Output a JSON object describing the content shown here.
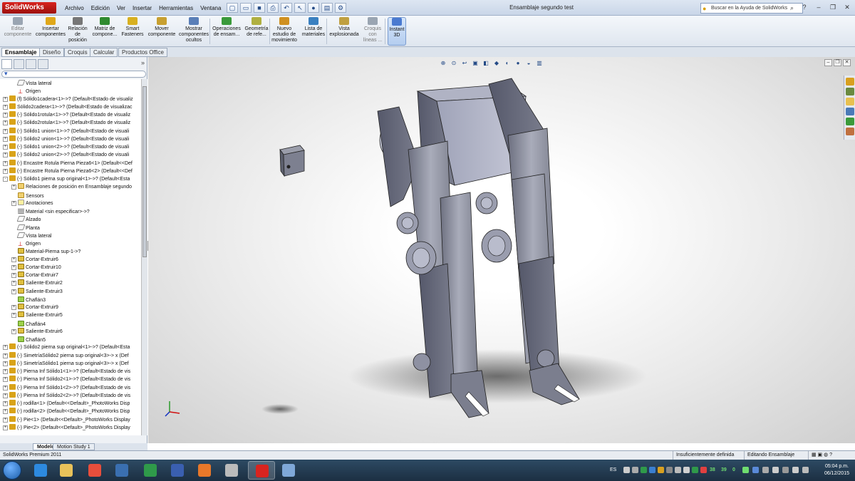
{
  "app": {
    "logo": "SolidWorks",
    "document_title": "Ensamblaje segundo test"
  },
  "menu": [
    "Archivo",
    "Edición",
    "Ver",
    "Insertar",
    "Herramientas",
    "Ventana"
  ],
  "help_search": {
    "placeholder": "Buscar en la Ayuda de SolidWorks"
  },
  "commands": [
    {
      "label": "Editar componente",
      "lines": [
        "Editar",
        "componente"
      ],
      "dim": true,
      "color": "#9aa5b2"
    },
    {
      "label": "Insertar componentes",
      "lines": [
        "Insertar",
        "componentes"
      ],
      "color": "#e0a81a"
    },
    {
      "label": "Relación de posición",
      "lines": [
        "Relación",
        "de",
        "posición"
      ],
      "color": "#777777"
    },
    {
      "label": "Matriz de componente",
      "lines": [
        "Matriz de",
        "compone..."
      ],
      "color": "#2f8a2f"
    },
    {
      "label": "Smart Fasteners",
      "lines": [
        "Smart",
        "Fasteners"
      ],
      "color": "#d8b020"
    },
    {
      "label": "Mover componente",
      "lines": [
        "Mover",
        "componente"
      ],
      "color": "#c8a030"
    },
    {
      "label": "Mostrar componentes ocultos",
      "lines": [
        "Mostrar",
        "componentes",
        "ocultos"
      ],
      "color": "#5a7fb8"
    },
    {
      "label": "Operaciones de ensamblaje",
      "lines": [
        "Operaciones",
        "de ensam..."
      ],
      "color": "#3a9a3a"
    },
    {
      "label": "Geometría de referencia",
      "lines": [
        "Geometría",
        "de refe..."
      ],
      "color": "#b0b040"
    },
    {
      "label": "Nuevo estudio de movimiento",
      "lines": [
        "Nuevo",
        "estudio de",
        "movimiento"
      ],
      "color": "#d09020"
    },
    {
      "label": "Lista de materiales",
      "lines": [
        "Lista de",
        "materiales"
      ],
      "color": "#3a80c0"
    },
    {
      "label": "Vista explosionada",
      "lines": [
        "Vista",
        "explosionada"
      ],
      "color": "#c0a040"
    },
    {
      "label": "Croquis con líneas",
      "lines": [
        "Croquis",
        "con",
        "líneas ..."
      ],
      "dim": true,
      "color": "#9aa5b2"
    },
    {
      "label": "Instant 3D",
      "lines": [
        "Instant",
        "3D"
      ],
      "active": true,
      "color": "#4a7ad0"
    }
  ],
  "command_tabs": [
    "Ensamblaje",
    "Diseño",
    "Croquis",
    "Calcular",
    "Productos Office"
  ],
  "tree": [
    {
      "label": "Vista lateral",
      "icon": "plane",
      "indent": 1,
      "exp": ""
    },
    {
      "label": "Origen",
      "icon": "origin",
      "indent": 1,
      "exp": ""
    },
    {
      "label": "(f) Sólido1cadera<1>->? (Default<Estado de visualiz",
      "icon": "part",
      "indent": 0,
      "exp": "+"
    },
    {
      "label": "Sólido2cadera<1>->? (Default<Estado de visualizac",
      "icon": "part",
      "indent": 0,
      "exp": "+"
    },
    {
      "label": "(-) Sólido1rotula<1>->? (Default<Estado de visualiz",
      "icon": "part",
      "indent": 0,
      "exp": "+"
    },
    {
      "label": "(-) Sólido2rotula<1>->? (Default<Estado de visualiz",
      "icon": "part",
      "indent": 0,
      "exp": "+"
    },
    {
      "label": "(-) Sólido1 union<1>->? (Default<Estado de visuali",
      "icon": "part",
      "indent": 0,
      "exp": "+"
    },
    {
      "label": "(-) Sólido2 union<1>->? (Default<Estado de visuali",
      "icon": "part",
      "indent": 0,
      "exp": "+"
    },
    {
      "label": "(-) Sólido1 union<2>->? (Default<Estado de visuali",
      "icon": "part",
      "indent": 0,
      "exp": "+"
    },
    {
      "label": "(-) Sólido2 union<2>->? (Default<Estado de visuali",
      "icon": "part",
      "indent": 0,
      "exp": "+"
    },
    {
      "label": "(-) Encastre Rotula Pierna Pieza6<1> (Default<<Def",
      "icon": "part",
      "indent": 0,
      "exp": "+"
    },
    {
      "label": "(-) Encastre Rotula Pierna Pieza6<2> (Default<<Def",
      "icon": "part",
      "indent": 0,
      "exp": "+"
    },
    {
      "label": "(-) Sólido1 pierna sup original<1>->? (Default<Esta",
      "icon": "part",
      "indent": 0,
      "exp": "-"
    },
    {
      "label": "Relaciones de posición en Ensamblaje segundo",
      "icon": "folder",
      "indent": 1,
      "exp": "+"
    },
    {
      "label": "Sensors",
      "icon": "folder",
      "indent": 1,
      "exp": ""
    },
    {
      "label": "Anotaciones",
      "icon": "note",
      "indent": 1,
      "exp": "+"
    },
    {
      "label": "Material <sin especificar>->?",
      "icon": "mat",
      "indent": 1,
      "exp": ""
    },
    {
      "label": "Alzado",
      "icon": "plane",
      "indent": 1,
      "exp": ""
    },
    {
      "label": "Planta",
      "icon": "plane",
      "indent": 1,
      "exp": ""
    },
    {
      "label": "Vista lateral",
      "icon": "plane",
      "indent": 1,
      "exp": ""
    },
    {
      "label": "Origen",
      "icon": "origin",
      "indent": 1,
      "exp": ""
    },
    {
      "label": "Material-Pierna sup-1->?",
      "icon": "feat",
      "indent": 1,
      "exp": ""
    },
    {
      "label": "Cortar-Extruir6",
      "icon": "feat",
      "indent": 1,
      "exp": "+"
    },
    {
      "label": "Cortar-Extruir10",
      "icon": "feat",
      "indent": 1,
      "exp": "+"
    },
    {
      "label": "Cortar-Extruir7",
      "icon": "feat",
      "indent": 1,
      "exp": "+"
    },
    {
      "label": "Saliente-Extruir2",
      "icon": "feat",
      "indent": 1,
      "exp": "+"
    },
    {
      "label": "Saliente-Extruir3",
      "icon": "feat",
      "indent": 1,
      "exp": "+"
    },
    {
      "label": "Chaflán3",
      "icon": "chamfer",
      "indent": 1,
      "exp": ""
    },
    {
      "label": "Cortar-Extruir9",
      "icon": "feat",
      "indent": 1,
      "exp": "+"
    },
    {
      "label": "Saliente-Extruir5",
      "icon": "feat",
      "indent": 1,
      "exp": "+"
    },
    {
      "label": "Chaflán4",
      "icon": "chamfer",
      "indent": 1,
      "exp": ""
    },
    {
      "label": "Saliente-Extruir6",
      "icon": "feat",
      "indent": 1,
      "exp": "+"
    },
    {
      "label": "Chaflán5",
      "icon": "chamfer",
      "indent": 1,
      "exp": ""
    },
    {
      "label": "(-) Sólido2 pierna sup original<1>->? (Default<Esta",
      "icon": "part",
      "indent": 0,
      "exp": "+"
    },
    {
      "label": "(-) SimetríaSólido2 pierna sup original<3>-> x (Def",
      "icon": "part",
      "indent": 0,
      "exp": "+"
    },
    {
      "label": "(-) SimetríaSólido1 pierna sup original<3>-> x (Def",
      "icon": "part",
      "indent": 0,
      "exp": "+"
    },
    {
      "label": "(-) Pierna Inf Sólido1<1>->? (Default<Estado de vis",
      "icon": "part",
      "indent": 0,
      "exp": "+"
    },
    {
      "label": "(-) Pierna Inf Sólido2<1>->? (Default<Estado de vis",
      "icon": "part",
      "indent": 0,
      "exp": "+"
    },
    {
      "label": "(-) Pierna Inf Sólido1<2>->? (Default<Estado de vis",
      "icon": "part",
      "indent": 0,
      "exp": "+"
    },
    {
      "label": "(-) Pierna Inf Sólido2<2>->? (Default<Estado de vis",
      "icon": "part",
      "indent": 0,
      "exp": "+"
    },
    {
      "label": "(-) rodilla<1> (Default<<Default>_PhotoWorks Disp",
      "icon": "part",
      "indent": 0,
      "exp": "+"
    },
    {
      "label": "(-) rodilla<2> (Default<<Default>_PhotoWorks Disp",
      "icon": "part",
      "indent": 0,
      "exp": "+"
    },
    {
      "label": "(-) Pie<1> (Default<<Default>_PhotoWorks Display",
      "icon": "part",
      "indent": 0,
      "exp": "+"
    },
    {
      "label": "(-) Pie<2> (Default<<Default>_PhotoWorks Display",
      "icon": "part",
      "indent": 0,
      "exp": "+"
    }
  ],
  "bottom_tabs": [
    "Modelo",
    "Motion Study 1"
  ],
  "status": {
    "product": "SolidWorks Premium 2011",
    "definition": "Insuficientemente definida",
    "mode": "Editando Ensamblaje"
  },
  "tray": {
    "lang": "ES",
    "num1": "38",
    "num2": "39",
    "num3": "0"
  },
  "clock": {
    "time": "05:04 p.m.",
    "date": "06/12/2015"
  },
  "taskbar_apps": [
    {
      "name": "internet-explorer",
      "color": "#2d8ae0"
    },
    {
      "name": "file-explorer",
      "color": "#e8c25a"
    },
    {
      "name": "chrome",
      "color": "#e84e3c"
    },
    {
      "name": "thunderbird",
      "color": "#3a6fb0"
    },
    {
      "name": "spreadsheet-app",
      "color": "#2f9a4a"
    },
    {
      "name": "remote-desktop",
      "color": "#3a5fb0"
    },
    {
      "name": "firefox",
      "color": "#e8782a"
    },
    {
      "name": "media-app",
      "color": "#bbbbbb"
    },
    {
      "name": "solidworks",
      "color": "#d8241f"
    },
    {
      "name": "notepad-app",
      "color": "#7fa8d8"
    }
  ]
}
